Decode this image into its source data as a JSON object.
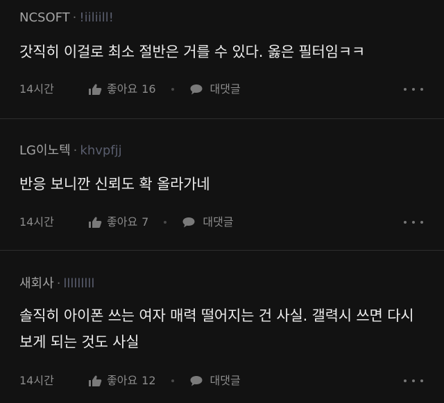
{
  "comments": [
    {
      "author": "NCSOFT",
      "separator": "·",
      "user_id": "!iiliill!",
      "text": "갓직히 이걸로 최소 절반은 거를 수 있다. 옳은 필터임ㅋㅋ",
      "time": "14시간",
      "like_label": "좋아요",
      "like_count": "16",
      "reply_label": "대댓글"
    },
    {
      "author": "LG이노텍",
      "separator": "·",
      "user_id": "khvpfjj",
      "text": "반응 보니깐 신뢰도 확 올라가네",
      "time": "14시간",
      "like_label": "좋아요",
      "like_count": "7",
      "reply_label": "대댓글"
    },
    {
      "author": "새회사",
      "separator": "·",
      "user_id": "lllllllll",
      "text": "솔직히 아이폰 쓰는 여자 매력 떨어지는 건 사실. 갤력시 쓰면 다시 보게 되는 것도 사실",
      "time": "14시간",
      "like_label": "좋아요",
      "like_count": "12",
      "reply_label": "대댓글"
    }
  ],
  "icons": {
    "like": "thumbs-up-icon",
    "reply": "speech-bubble-icon",
    "more": "more-dots-icon"
  },
  "colors": {
    "background": "#121212",
    "text": "#ececec",
    "meta": "#8c8c8c",
    "user_id": "#5a5e6e"
  }
}
